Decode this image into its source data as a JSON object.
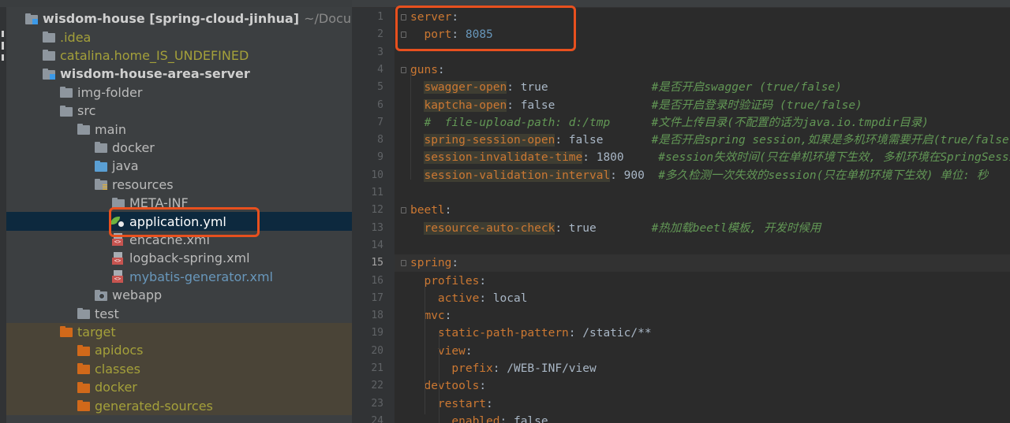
{
  "tree": {
    "items": [
      {
        "label": "wisdom-house [spring-cloud-jinhua]",
        "suffix": "~/Documents/",
        "arrow": "▼",
        "icon": "module-folder-icon",
        "style": "bold"
      },
      {
        "label": ".idea",
        "arrow": "▶",
        "icon": "folder-icon",
        "style": "olive"
      },
      {
        "label": "catalina.home_IS_UNDEFINED",
        "arrow": "▶",
        "icon": "folder-icon",
        "style": "olive"
      },
      {
        "label": "wisdom-house-area-server",
        "arrow": "▼",
        "icon": "module-folder-icon",
        "style": "bold"
      },
      {
        "label": "img-folder",
        "arrow": "▶",
        "icon": "folder-icon",
        "style": "gray"
      },
      {
        "label": "src",
        "arrow": "▼",
        "icon": "folder-icon",
        "style": "gray"
      },
      {
        "label": "main",
        "arrow": "▼",
        "icon": "folder-icon",
        "style": "gray"
      },
      {
        "label": "docker",
        "arrow": "▶",
        "icon": "folder-icon",
        "style": "gray"
      },
      {
        "label": "java",
        "arrow": "▶",
        "icon": "source-folder-icon",
        "style": "gray"
      },
      {
        "label": "resources",
        "arrow": "▼",
        "icon": "resources-folder-icon",
        "style": "gray"
      },
      {
        "label": "META-INF",
        "arrow": "▶",
        "icon": "folder-icon",
        "style": "gray"
      },
      {
        "label": "application.yml",
        "arrow": "",
        "icon": "yml-file-icon",
        "style": "white",
        "selected": true
      },
      {
        "label": "encache.xml",
        "arrow": "",
        "icon": "xml-file-icon",
        "style": "gray"
      },
      {
        "label": "logback-spring.xml",
        "arrow": "",
        "icon": "xml-file-icon",
        "style": "gray"
      },
      {
        "label": "mybatis-generator.xml",
        "arrow": "",
        "icon": "xml-file-icon",
        "style": "blue"
      },
      {
        "label": "webapp",
        "arrow": "▶",
        "icon": "web-folder-icon",
        "style": "gray"
      },
      {
        "label": "test",
        "arrow": "▶",
        "icon": "folder-icon",
        "style": "gray"
      },
      {
        "label": "target",
        "arrow": "▼",
        "icon": "excluded-folder-icon",
        "style": "olive",
        "excluded": true
      },
      {
        "label": "apidocs",
        "arrow": "▶",
        "icon": "excluded-folder-icon",
        "style": "olive",
        "excluded": true
      },
      {
        "label": "classes",
        "arrow": "▶",
        "icon": "excluded-folder-icon",
        "style": "olive",
        "excluded": true
      },
      {
        "label": "docker",
        "arrow": "▶",
        "icon": "excluded-folder-icon",
        "style": "olive",
        "excluded": true
      },
      {
        "label": "generated-sources",
        "arrow": "▶",
        "icon": "excluded-folder-icon",
        "style": "olive",
        "excluded": true
      }
    ]
  },
  "editor": {
    "current_line": 15,
    "lines": [
      [
        {
          "t": "server",
          "c": "key"
        },
        {
          "t": ":",
          "c": "val"
        }
      ],
      [
        {
          "t": "  "
        },
        {
          "t": "port",
          "c": "key"
        },
        {
          "t": ": "
        },
        {
          "t": "8085",
          "c": "num"
        }
      ],
      [],
      [
        {
          "t": "guns",
          "c": "key"
        },
        {
          "t": ":",
          "c": "val"
        }
      ],
      [
        {
          "t": "  "
        },
        {
          "t": "swagger-open",
          "c": "keybg"
        },
        {
          "t": ": true               "
        },
        {
          "t": "#是否开启swagger (true/false)",
          "c": "cmt"
        }
      ],
      [
        {
          "t": "  "
        },
        {
          "t": "kaptcha-open",
          "c": "keybg"
        },
        {
          "t": ": false              "
        },
        {
          "t": "#是否开启登录时验证码 (true/false)",
          "c": "cmt"
        }
      ],
      [
        {
          "t": "  "
        },
        {
          "t": "#  file-upload-path: d:/tmp      #文件上传目录(不配置的话为java.io.tmpdir目录)",
          "c": "cmt"
        }
      ],
      [
        {
          "t": "  "
        },
        {
          "t": "spring-session-open",
          "c": "keybg"
        },
        {
          "t": ": false       "
        },
        {
          "t": "#是否开启spring session,如果是多机环境需要开启(true/false)",
          "c": "cmt"
        }
      ],
      [
        {
          "t": "  "
        },
        {
          "t": "session-invalidate-time",
          "c": "keybg"
        },
        {
          "t": ": 1800     "
        },
        {
          "t": "#session失效时间(只在单机环境下生效, 多机环境在SpringSession",
          "c": "cmt"
        }
      ],
      [
        {
          "t": "  "
        },
        {
          "t": "session-validation-interval",
          "c": "keybg"
        },
        {
          "t": ": 900  "
        },
        {
          "t": "#多久检测一次失效的session(只在单机环境下生效) 单位: 秒",
          "c": "cmt"
        }
      ],
      [],
      [
        {
          "t": "beetl",
          "c": "key"
        },
        {
          "t": ":",
          "c": "val"
        }
      ],
      [
        {
          "t": "  "
        },
        {
          "t": "resource-auto-check",
          "c": "keybg"
        },
        {
          "t": ": true        "
        },
        {
          "t": "#热加载beetl模板, 开发时候用",
          "c": "cmt"
        }
      ],
      [],
      [
        {
          "t": "spring",
          "c": "key"
        },
        {
          "t": ":",
          "c": "val"
        }
      ],
      [
        {
          "t": "  "
        },
        {
          "t": "profiles",
          "c": "key"
        },
        {
          "t": ":"
        }
      ],
      [
        {
          "t": "    "
        },
        {
          "t": "active",
          "c": "key"
        },
        {
          "t": ": local"
        }
      ],
      [
        {
          "t": "  "
        },
        {
          "t": "mvc",
          "c": "key"
        },
        {
          "t": ":"
        }
      ],
      [
        {
          "t": "    "
        },
        {
          "t": "static-path-pattern",
          "c": "key"
        },
        {
          "t": ": /static/**"
        }
      ],
      [
        {
          "t": "    "
        },
        {
          "t": "view",
          "c": "key"
        },
        {
          "t": ":"
        }
      ],
      [
        {
          "t": "      "
        },
        {
          "t": "prefix",
          "c": "key"
        },
        {
          "t": ": /WEB-INF/view"
        }
      ],
      [
        {
          "t": "  "
        },
        {
          "t": "devtools",
          "c": "key"
        },
        {
          "t": ":"
        }
      ],
      [
        {
          "t": "    "
        },
        {
          "t": "restart",
          "c": "key"
        },
        {
          "t": ":"
        }
      ],
      [
        {
          "t": "      "
        },
        {
          "t": "enabled",
          "c": "key"
        },
        {
          "t": ": false"
        }
      ]
    ],
    "line_numbers": [
      "1",
      "2",
      "3",
      "4",
      "5",
      "6",
      "7",
      "8",
      "9",
      "10",
      "11",
      "12",
      "13",
      "14",
      "15",
      "16",
      "17",
      "18",
      "19",
      "20",
      "21",
      "22",
      "23",
      "24"
    ]
  },
  "colors": {
    "highlight": "#e8501e",
    "selection": "#0d293e",
    "excluded": "#4a4437"
  }
}
